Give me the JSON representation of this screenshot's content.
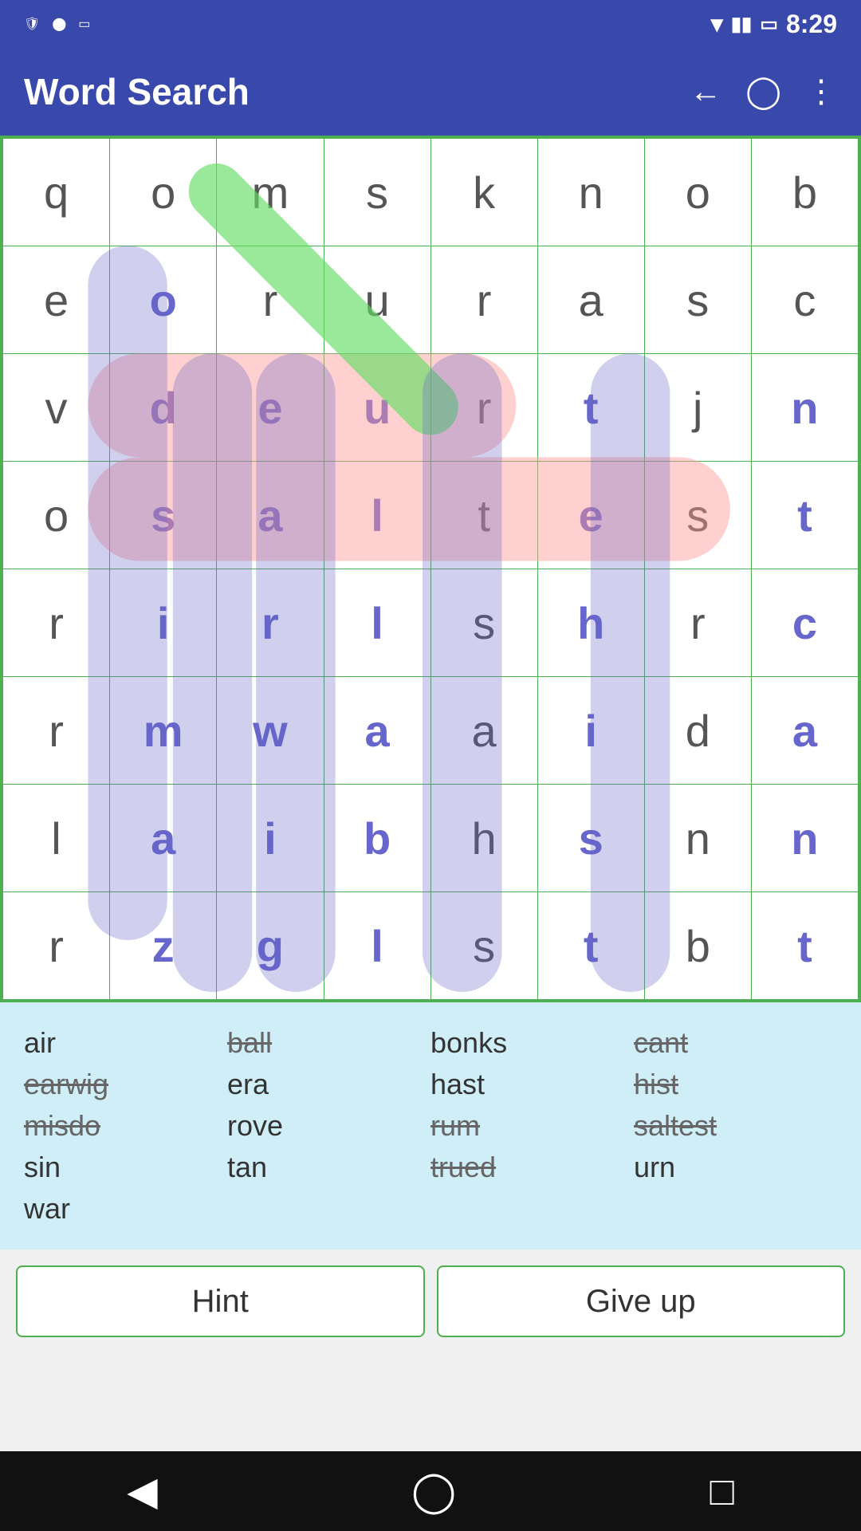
{
  "app": {
    "title": "Word Search"
  },
  "status": {
    "time": "8:29"
  },
  "grid": {
    "rows": [
      [
        "q",
        "o",
        "m",
        "s",
        "k",
        "n",
        "o",
        "b"
      ],
      [
        "e",
        "o",
        "r",
        "u",
        "r",
        "a",
        "s",
        "c"
      ],
      [
        "v",
        "d",
        "e",
        "u",
        "r",
        "t",
        "j",
        "n"
      ],
      [
        "o",
        "s",
        "a",
        "l",
        "t",
        "e",
        "s",
        "t"
      ],
      [
        "r",
        "i",
        "r",
        "l",
        "s",
        "h",
        "r",
        "c"
      ],
      [
        "r",
        "m",
        "w",
        "a",
        "a",
        "i",
        "d",
        "a"
      ],
      [
        "l",
        "a",
        "i",
        "b",
        "h",
        "s",
        "n",
        "n"
      ],
      [
        "r",
        "z",
        "g",
        "l",
        "s",
        "t",
        "b",
        "t"
      ]
    ]
  },
  "words": [
    {
      "text": "air",
      "found": false
    },
    {
      "text": "ball",
      "found": true
    },
    {
      "text": "bonks",
      "found": false
    },
    {
      "text": "cant",
      "found": true
    },
    {
      "text": "earwig",
      "found": true
    },
    {
      "text": "era",
      "found": false
    },
    {
      "text": "hast",
      "found": false
    },
    {
      "text": "hist",
      "found": true
    },
    {
      "text": "misdo",
      "found": true
    },
    {
      "text": "rove",
      "found": false
    },
    {
      "text": "rum",
      "found": true
    },
    {
      "text": "saltest",
      "found": true
    },
    {
      "text": "sin",
      "found": false
    },
    {
      "text": "tan",
      "found": false
    },
    {
      "text": "trued",
      "found": true
    },
    {
      "text": "urn",
      "found": false
    },
    {
      "text": "war",
      "found": false
    }
  ],
  "buttons": {
    "hint": "Hint",
    "giveup": "Give up"
  },
  "highlights": {
    "blue_columns": [
      {
        "col": 1,
        "row_start": 1,
        "row_end": 7
      },
      {
        "col": 2,
        "row_start": 2,
        "row_end": 7
      },
      {
        "col": 3,
        "row_start": 2,
        "row_end": 7
      },
      {
        "col": 5,
        "row_start": 2,
        "row_end": 7
      },
      {
        "col": 7,
        "row_start": 2,
        "row_end": 7
      }
    ]
  }
}
